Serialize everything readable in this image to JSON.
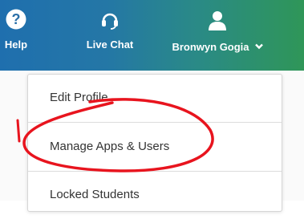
{
  "header": {
    "help_label": "Help",
    "chat_label": "Live Chat",
    "user_name": "Bronwyn Gogia"
  },
  "menu": {
    "items": [
      {
        "label": "Edit Profile"
      },
      {
        "label": "Manage Apps & Users"
      },
      {
        "label": "Locked Students"
      }
    ]
  },
  "colors": {
    "header_gradient_start": "#1f6fae",
    "header_gradient_end": "#2f9658",
    "annotation": "#e8141e"
  }
}
